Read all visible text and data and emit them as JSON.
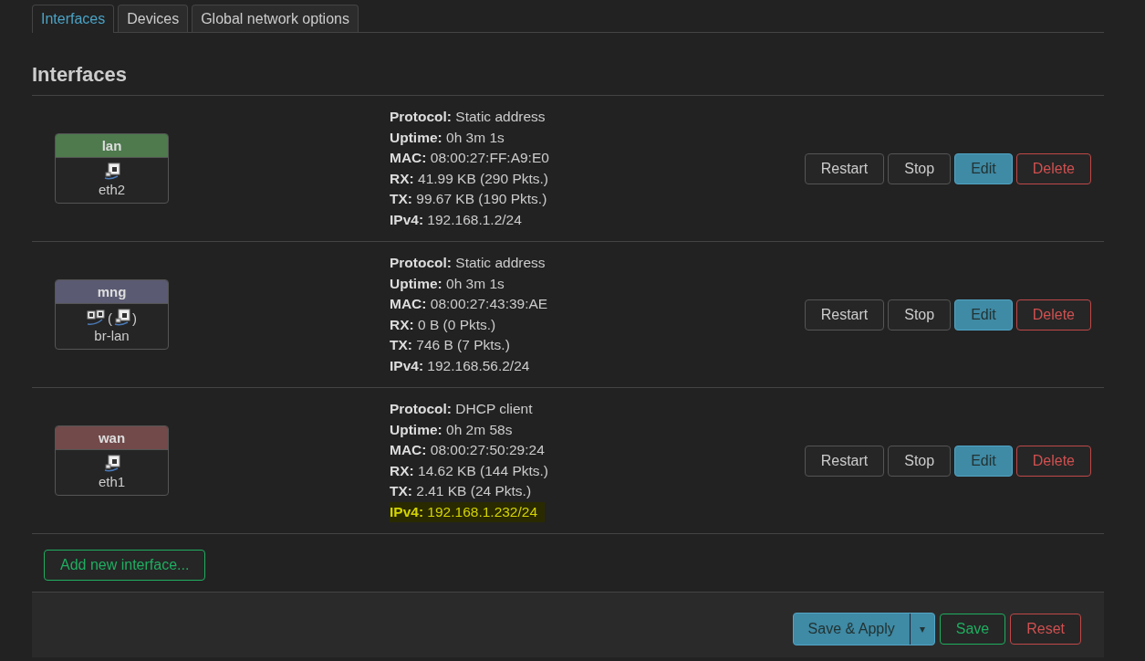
{
  "tabs": [
    {
      "label": "Interfaces",
      "selected": true
    },
    {
      "label": "Devices",
      "selected": false
    },
    {
      "label": "Global network options",
      "selected": false
    }
  ],
  "heading": "Interfaces",
  "interfaces": [
    {
      "name": "lan",
      "color": "#4e7a4e",
      "device_icons": [
        {
          "kind": "port"
        }
      ],
      "device": "eth2",
      "info": [
        {
          "label": "Protocol:",
          "value": "Static address",
          "highlighted": false
        },
        {
          "label": "Uptime:",
          "value": "0h 3m 1s",
          "highlighted": false
        },
        {
          "label": "MAC:",
          "value": "08:00:27:FF:A9:E0",
          "highlighted": false
        },
        {
          "label": "RX:",
          "value": "41.99 KB (290 Pkts.)",
          "highlighted": false
        },
        {
          "label": "TX:",
          "value": "99.67 KB (190 Pkts.)",
          "highlighted": false
        },
        {
          "label": "IPv4:",
          "value": "192.168.1.2/24",
          "highlighted": false
        }
      ],
      "buttons": [
        {
          "label": "Restart",
          "kind": "default"
        },
        {
          "label": "Stop",
          "kind": "default"
        },
        {
          "label": "Edit",
          "kind": "primary"
        },
        {
          "label": "Delete",
          "kind": "danger"
        }
      ]
    },
    {
      "name": "mng",
      "color": "#5a5a72",
      "device_icons": [
        {
          "kind": "bridge"
        },
        {
          "kind": "text",
          "text": "("
        },
        {
          "kind": "port"
        },
        {
          "kind": "text",
          "text": ")"
        }
      ],
      "device": "br-lan",
      "info": [
        {
          "label": "Protocol:",
          "value": "Static address",
          "highlighted": false
        },
        {
          "label": "Uptime:",
          "value": "0h 3m 1s",
          "highlighted": false
        },
        {
          "label": "MAC:",
          "value": "08:00:27:43:39:AE",
          "highlighted": false
        },
        {
          "label": "RX:",
          "value": "0 B (0 Pkts.)",
          "highlighted": false
        },
        {
          "label": "TX:",
          "value": "746 B (7 Pkts.)",
          "highlighted": false
        },
        {
          "label": "IPv4:",
          "value": "192.168.56.2/24",
          "highlighted": false
        }
      ],
      "buttons": [
        {
          "label": "Restart",
          "kind": "default"
        },
        {
          "label": "Stop",
          "kind": "default"
        },
        {
          "label": "Edit",
          "kind": "primary"
        },
        {
          "label": "Delete",
          "kind": "danger"
        }
      ]
    },
    {
      "name": "wan",
      "color": "#724a4a",
      "device_icons": [
        {
          "kind": "port"
        }
      ],
      "device": "eth1",
      "info": [
        {
          "label": "Protocol:",
          "value": "DHCP client",
          "highlighted": false
        },
        {
          "label": "Uptime:",
          "value": "0h 2m 58s",
          "highlighted": false
        },
        {
          "label": "MAC:",
          "value": "08:00:27:50:29:24",
          "highlighted": false
        },
        {
          "label": "RX:",
          "value": "14.62 KB (144 Pkts.)",
          "highlighted": false
        },
        {
          "label": "TX:",
          "value": "2.41 KB (24 Pkts.)",
          "highlighted": false
        },
        {
          "label": "IPv4:",
          "value": "192.168.1.232/24",
          "highlighted": true
        }
      ],
      "buttons": [
        {
          "label": "Restart",
          "kind": "default"
        },
        {
          "label": "Stop",
          "kind": "default"
        },
        {
          "label": "Edit",
          "kind": "primary"
        },
        {
          "label": "Delete",
          "kind": "danger"
        }
      ]
    }
  ],
  "add_button": "Add new interface...",
  "footer": {
    "apply": "Save & Apply",
    "dropdown": "▾",
    "save": "Save",
    "reset": "Reset"
  }
}
